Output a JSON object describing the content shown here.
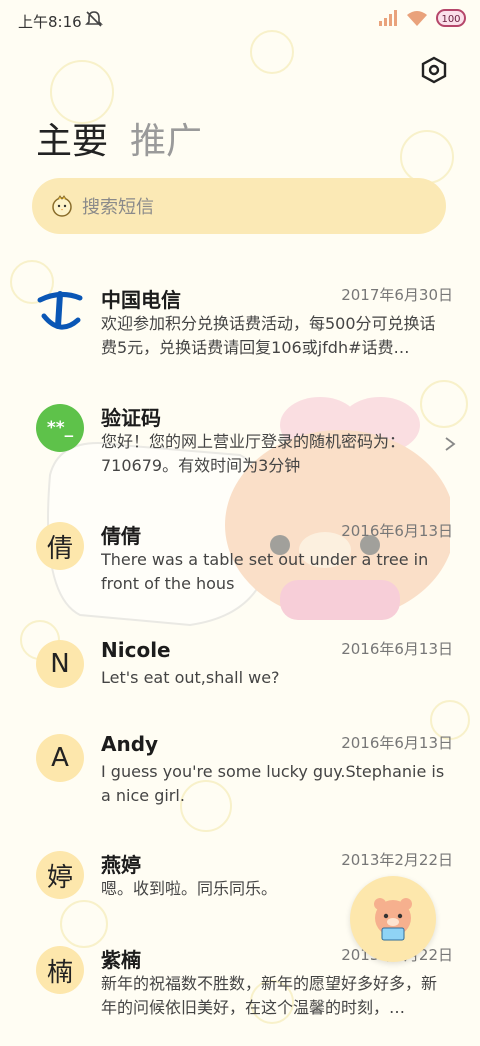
{
  "status_bar": {
    "time": "上午8:16",
    "battery": "100"
  },
  "tabs": [
    {
      "label": "主要"
    },
    {
      "label": "推广"
    }
  ],
  "search": {
    "placeholder": "搜索短信"
  },
  "conversations": [
    {
      "avatar": "",
      "name": "中国电信",
      "date": "2017年6月30日",
      "preview": "欢迎参加积分兑换话费活动，每500分可兑换话费5元，兑换话费请回复106或jfdh#话费…"
    },
    {
      "avatar": "**_",
      "name": "验证码",
      "date": "",
      "preview": "您好！您的网上营业厅登录的随机密码为：710679。有效时间为3分钟"
    },
    {
      "avatar": "倩",
      "name": "倩倩",
      "date": "2016年6月13日",
      "preview": "There was a table set out under a tree in front of the hous"
    },
    {
      "avatar": "N",
      "name": "Nicole",
      "date": "2016年6月13日",
      "preview": "Let's eat out,shall we?"
    },
    {
      "avatar": "A",
      "name": "Andy",
      "date": "2016年6月13日",
      "preview": "I guess you're some lucky guy.Stephanie is a nice girl."
    },
    {
      "avatar": "婷",
      "name": "燕婷",
      "date": "2013年2月22日",
      "preview": "嗯。收到啦。同乐同乐。"
    },
    {
      "avatar": "楠",
      "name": "紫楠",
      "date": "2013年2月22日",
      "preview": "新年的祝福数不胜数，新年的愿望好多好多，新年的问候依旧美好，在这个温馨的时刻，…"
    }
  ],
  "colors": {
    "search_bg": "#fbe9b5",
    "avatar_bg": "#fde7ac",
    "verify_green": "#5ec24a",
    "telecom_blue": "#0a56b5"
  }
}
